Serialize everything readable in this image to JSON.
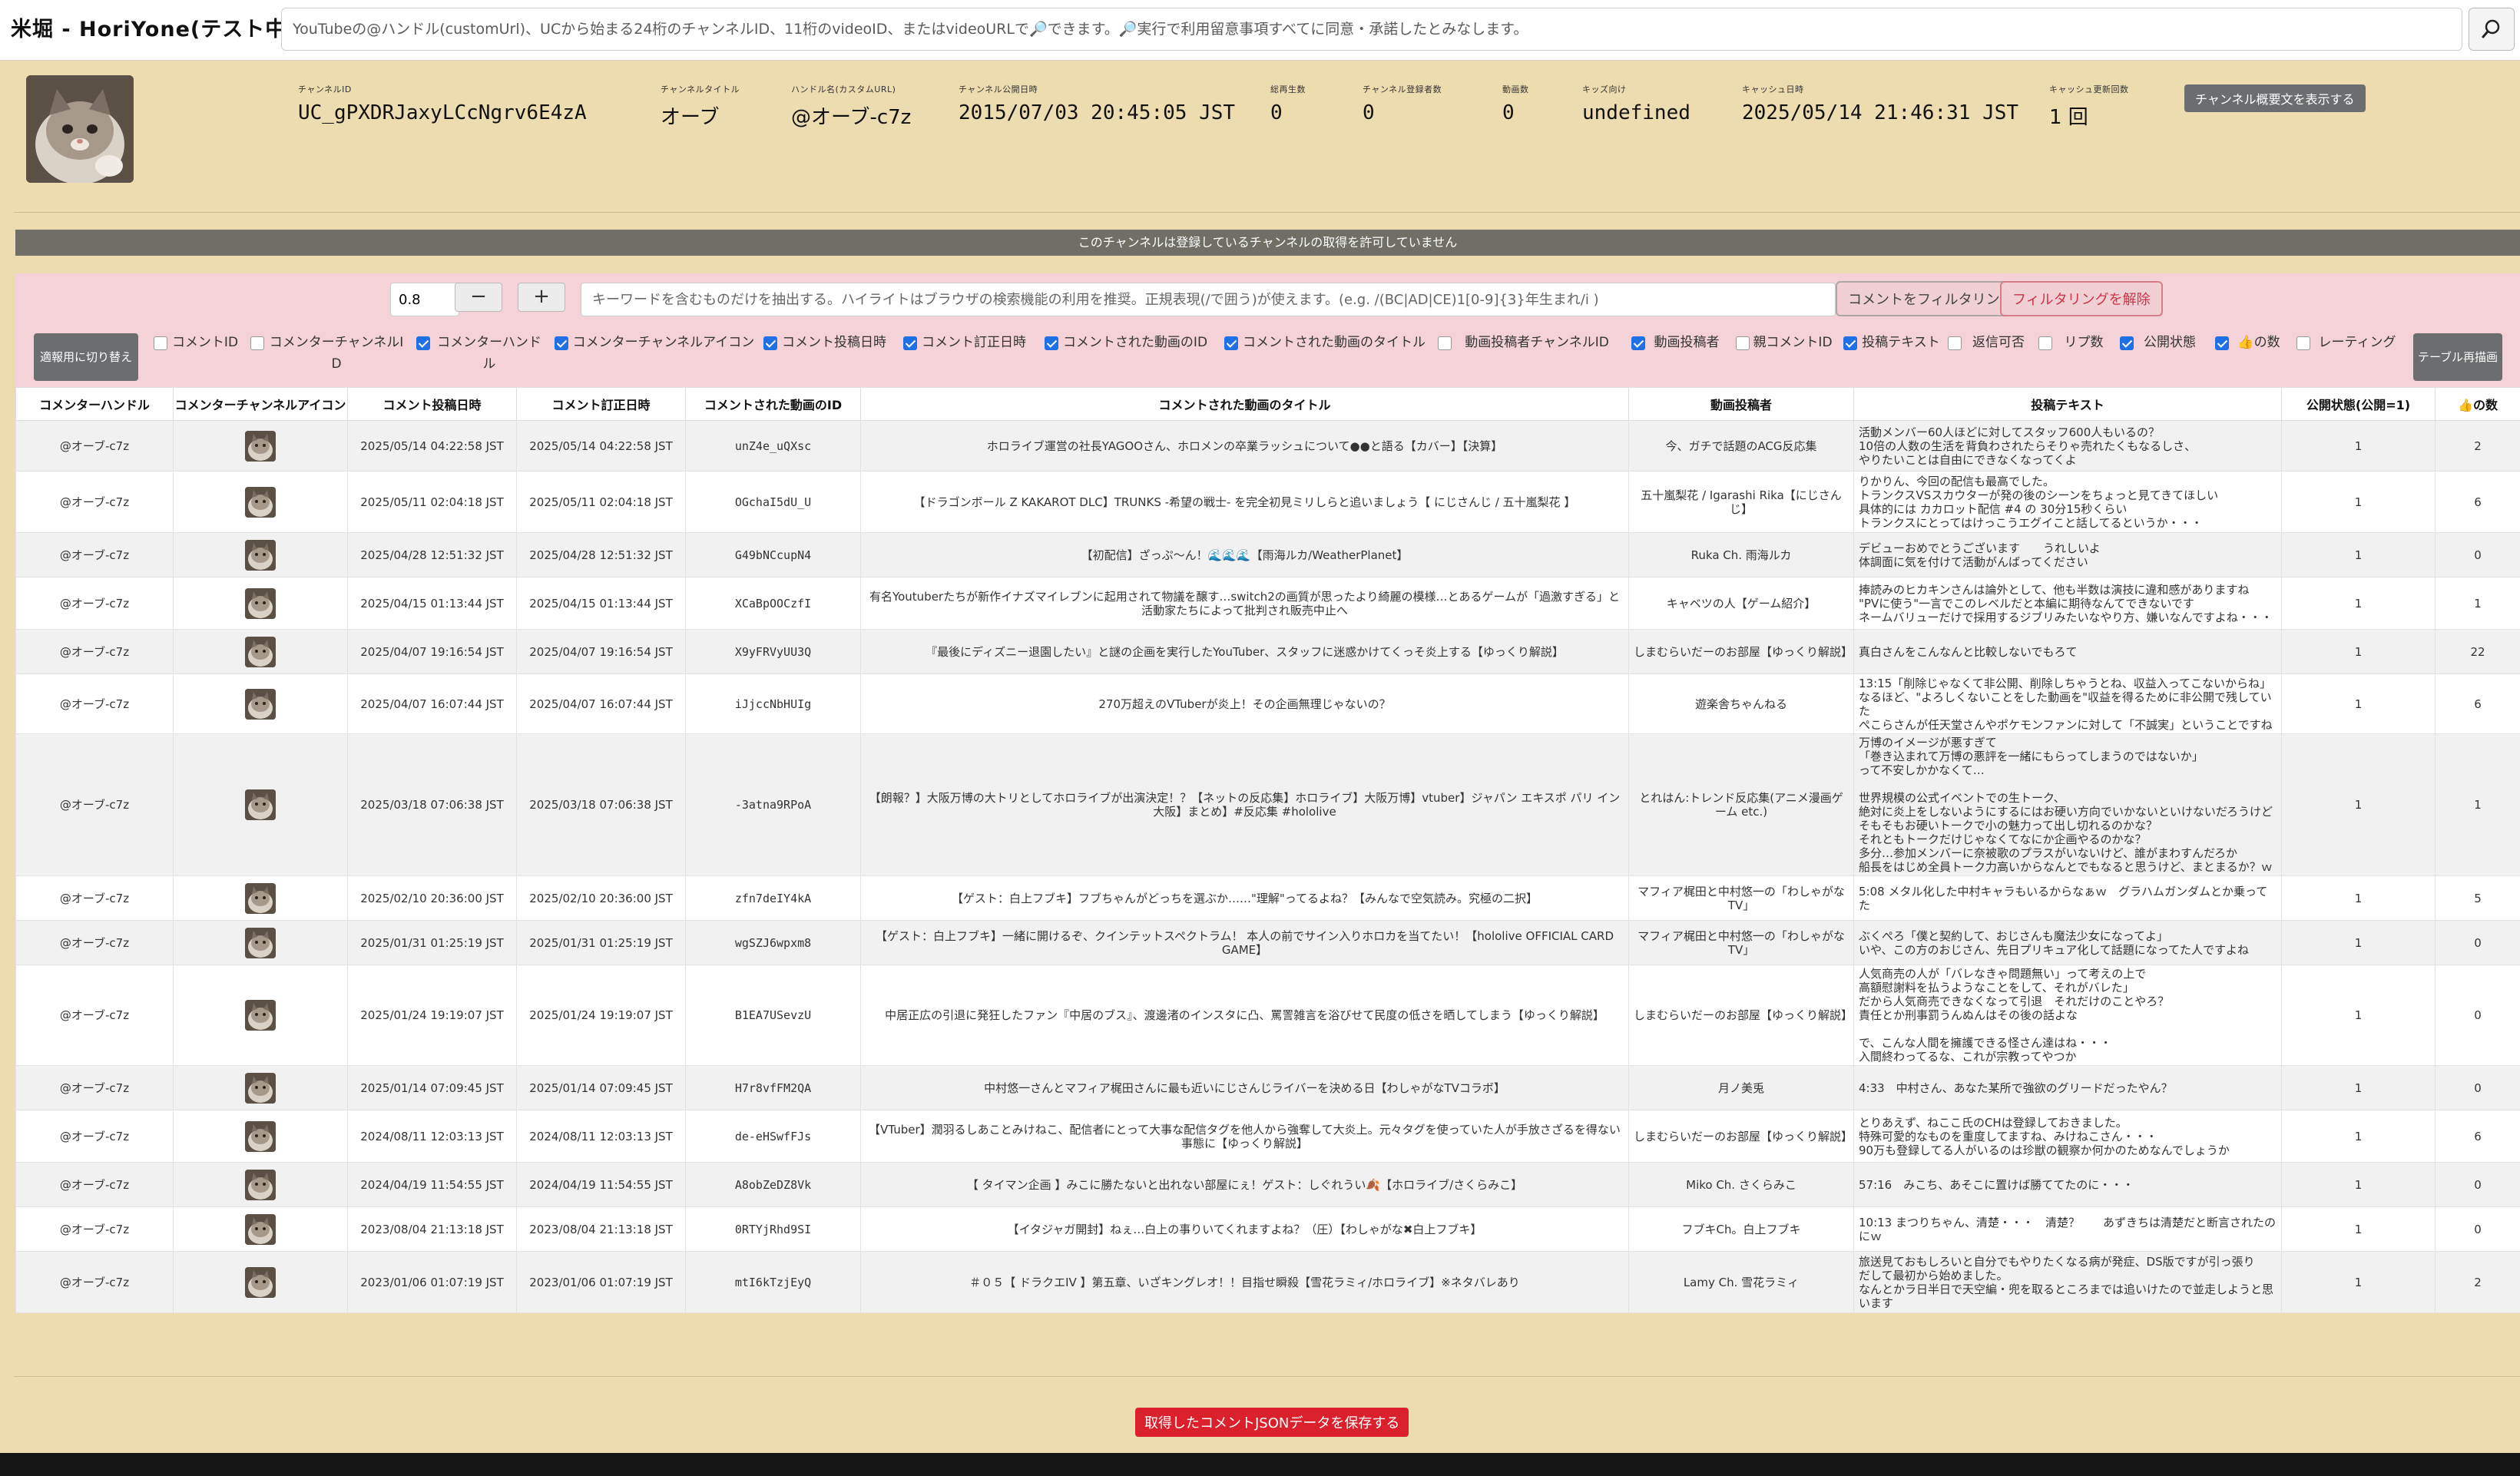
{
  "app": {
    "title": "米堀 - HoriYone(テスト中)",
    "search_placeholder": "YouTubeの@ハンドル(customUrl)、UCから始まる24桁のチャンネルID、11桁のvideoID、またはvideoURLで🔎できます。🔎実行で利用留意事項すべてに同意・承諾したとみなします。"
  },
  "channel": {
    "fields": [
      {
        "label": "チャンネルID",
        "value": "UC_gPXDRJaxyLCcNgrv6E4zA"
      },
      {
        "label": "チャンネルタイトル",
        "value": "オーブ"
      },
      {
        "label": "ハンドル名(カスタムURL)",
        "value": "@オーブ-c7z"
      },
      {
        "label": "チャンネル公開日時",
        "value": "2015/07/03 20:45:05 JST"
      },
      {
        "label": "総再生数",
        "value": "0"
      },
      {
        "label": "チャンネル登録者数",
        "value": "0"
      },
      {
        "label": "動画数",
        "value": "0"
      },
      {
        "label": "キッズ向け",
        "value": "undefined"
      },
      {
        "label": "キャッシュ日時",
        "value": "2025/05/14 21:46:31 JST"
      },
      {
        "label": "キャッシュ更新回数",
        "value": "1 回"
      }
    ],
    "show_description_label": "チャンネル概要文を表示する",
    "notice": "このチャンネルは登録しているチャンネルの取得を許可していません"
  },
  "filter": {
    "threshold_value": "0.8",
    "minus_label": "−",
    "plus_label": "+",
    "keyword_placeholder": "キーワードを含むものだけを抽出する。ハイライトはブラウザの検索機能の利用を推奨。正規表現(/で囲う)が使えます。(e.g. /(BC|AD|CE)1[0-9]{3}年生まれ/i )",
    "filter_button": "コメントをフィルタリング",
    "clear_button": "フィルタリングを解除",
    "toggle_button": "適報用に切り替え",
    "redraw_button": "テーブル再描画",
    "columns": [
      {
        "label": "コメントID",
        "checked": false
      },
      {
        "label": "コメンターチャンネルID",
        "checked": false
      },
      {
        "label": "コメンターハンドル",
        "checked": true
      },
      {
        "label": "コメンターチャンネルアイコン",
        "checked": true
      },
      {
        "label": "コメント投稿日時",
        "checked": true
      },
      {
        "label": "コメント訂正日時",
        "checked": true
      },
      {
        "label": "コメントされた動画のID",
        "checked": true
      },
      {
        "label": "コメントされた動画のタイトル",
        "checked": true
      },
      {
        "label": "動画投稿者チャンネルID",
        "checked": false
      },
      {
        "label": "動画投稿者",
        "checked": true
      },
      {
        "label": "親コメントID",
        "checked": false
      },
      {
        "label": "投稿テキスト",
        "checked": true
      },
      {
        "label": "返信可否",
        "checked": false
      },
      {
        "label": "リプ数",
        "checked": false
      },
      {
        "label": "公開状態",
        "checked": true
      },
      {
        "label": "👍の数",
        "checked": true
      },
      {
        "label": "レーティング",
        "checked": false
      }
    ]
  },
  "table": {
    "headers": [
      "コメンターハンドル",
      "コメンターチャンネルアイコン",
      "コメント投稿日時",
      "コメント訂正日時",
      "コメントされた動画のID",
      "コメントされた動画のタイトル",
      "動画投稿者",
      "投稿テキスト",
      "公開状態(公開=1)",
      "👍の数"
    ],
    "rows": [
      {
        "handle": "@オーブ-c7z",
        "posted": "2025/05/14 04:22:58 JST",
        "edited": "2025/05/14 04:22:58 JST",
        "video_id": "unZ4e_uQXsc",
        "title": "ホロライブ運営の社長YAGOOさん、ホロメンの卒業ラッシュについて●●と語る【カバー】【決算】",
        "uploader": "今、ガチで話題のACG反応集",
        "text": "活動メンバー60人ほどに対してスタッフ600人もいるの？\n10倍の人数の生活を背負わされたらそりゃ売れたくもなるしさ、\nやりたいことは自由にできなくなってくよ",
        "status": "1",
        "likes": "2"
      },
      {
        "handle": "@オーブ-c7z",
        "posted": "2025/05/11 02:04:18 JST",
        "edited": "2025/05/11 02:04:18 JST",
        "video_id": "OGchaI5dU_U",
        "title": "【ドラゴンボール Z KAKAROT DLC】TRUNKS -希望の戦士- を完全初見ミリしらと追いましょう【 にじさんじ / 五十嵐梨花 】",
        "uploader": "五十嵐梨花 / Igarashi Rika【にじさんじ】",
        "text": "りかりん、今回の配信も最高でした。\nトランクスVSスカウターが発の後のシーンをちょっと見てきてほしい\n具体的には カカロット配信 #4 の 30分15秒くらい\nトランクスにとってはけっこうエグイこと話してるというか・・・",
        "status": "1",
        "likes": "6"
      },
      {
        "handle": "@オーブ-c7z",
        "posted": "2025/04/28 12:51:32 JST",
        "edited": "2025/04/28 12:51:32 JST",
        "video_id": "G49bNCcupN4",
        "title": "【初配信】ざっぷ～ん！🌊🌊🌊【雨海ルカ/WeatherPlanet】",
        "uploader": "Ruka Ch. 雨海ルカ",
        "text": "デビューおめでとうございます　　うれしいよ\n体調面に気を付けて活動がんばってください",
        "status": "1",
        "likes": "0"
      },
      {
        "handle": "@オーブ-c7z",
        "posted": "2025/04/15 01:13:44 JST",
        "edited": "2025/04/15 01:13:44 JST",
        "video_id": "XCaBpOOCzfI",
        "title": "有名Youtuberたちが新作イナズマイレブンに起用されて物議を醸す…switch2の画質が思ったより綺麗の模様…とあるゲームが「過激すぎる」と活動家たちによって批判され販売中止へ",
        "uploader": "キャベツの人【ゲーム紹介】",
        "text": "捧読みのヒカキンさんは論外として、他も半数は演技に違和感がありますね\n\"PVに使う\"一言でこのレベルだと本編に期待なんてできないです\nネームバリューだけで採用するジブリみたいなやり方、嫌いなんですよね・・・",
        "status": "1",
        "likes": "1"
      },
      {
        "handle": "@オーブ-c7z",
        "posted": "2025/04/07 19:16:54 JST",
        "edited": "2025/04/07 19:16:54 JST",
        "video_id": "X9yFRVyUU3Q",
        "title": "『最後にディズニー退園したい』と謎の企画を実行したYouTuber、スタッフに迷惑かけてくっそ炎上する【ゆっくり解説】",
        "uploader": "しまむらいだーのお部屋【ゆっくり解説】",
        "text": "真白さんをこんなんと比較しないでもろて",
        "status": "1",
        "likes": "22"
      },
      {
        "handle": "@オーブ-c7z",
        "posted": "2025/04/07 16:07:44 JST",
        "edited": "2025/04/07 16:07:44 JST",
        "video_id": "iJjccNbHUIg",
        "title": "270万超えのVTuberが炎上！その企画無理じゃないの？",
        "uploader": "遊楽舎ちゃんねる",
        "text": "13:15「削除じゃなくて非公開、削除しちゃうとね、収益入ってこないからね」\nなるほど、\"よろしくないことをした動画を\"収益を得るために非公開で残していた\nぺこらさんが任天堂さんやポケモンファンに対して「不誠実」ということですね",
        "status": "1",
        "likes": "6"
      },
      {
        "handle": "@オーブ-c7z",
        "posted": "2025/03/18 07:06:38 JST",
        "edited": "2025/03/18 07:06:38 JST",
        "video_id": "-3atna9RPoA",
        "title": "【朗報？】大阪万博の大トリとしてホロライブが出演決定！？【ネットの反応集】ホロライブ】大阪万博】vtuber】ジャパン エキスポ パリ イン 大阪】まとめ】#反応集 #hololive",
        "uploader": "とれはん:トレンド反応集(アニメ漫画ゲーム etc.)",
        "text": "万博のイメージが悪すぎて\n「巻き込まれて万博の悪評を一緒にもらってしまうのではないか」\nって不安しかかなくて…\n\n世界規模の公式イベントでの生トーク、\n絶対に炎上をしないようにするにはお硬い方向でいかないといけないだろうけど\nそもそもお硬いトークで小の魅力って出し切れるのかな？\nそれともトークだけじゃなくてなにか企画やるのかな？\n多分…参加メンバーに奈被歌のプラスがいないけど、誰がまわすんだろか\n船長をはじめ全員トーク力高いからなんとでもなると思うけど、まとまるか？ｗ",
        "status": "1",
        "likes": "1"
      },
      {
        "handle": "@オーブ-c7z",
        "posted": "2025/02/10 20:36:00 JST",
        "edited": "2025/02/10 20:36:00 JST",
        "video_id": "zfn7deIY4kA",
        "title": "【ゲスト：白上フブキ】フブちゃんがどっちを選ぶか……\"理解\"ってるよね？【みんなで空気読み。究極の二択】",
        "uploader": "マフィア梶田と中村悠一の「わしゃがなTV」",
        "text": "5:08 メタル化した中村キャラもいるからなぁｗ　グラハムガンダムとか乗ってた",
        "status": "1",
        "likes": "5"
      },
      {
        "handle": "@オーブ-c7z",
        "posted": "2025/01/31 01:25:19 JST",
        "edited": "2025/01/31 01:25:19 JST",
        "video_id": "wgSZJ6wpxm8",
        "title": "【ゲスト：白上フブキ】一緒に開けるぞ、クインテットスペクトラム！ 本人の前でサイン入りホロカを当てたい！【hololive OFFICIAL CARD GAME】",
        "uploader": "マフィア梶田と中村悠一の「わしゃがなTV」",
        "text": "ぶくぺろ「僕と契約して、おじさんも魔法少女になってよ」\nいや、この方のおじさん、先日プリキュア化して話題になってた人ですよね",
        "status": "1",
        "likes": "0"
      },
      {
        "handle": "@オーブ-c7z",
        "posted": "2025/01/24 19:19:07 JST",
        "edited": "2025/01/24 19:19:07 JST",
        "video_id": "B1EA7USevzU",
        "title": "中居正広の引退に発狂したファン『中居のブス』、渡邊渚のインスタに凸、罵詈雑言を浴びせて民度の低さを晒してしまう【ゆっくり解説】",
        "uploader": "しまむらいだーのお部屋【ゆっくり解説】",
        "text": "人気商売の人が「バレなきゃ問題無い」って考えの上で\n高額慰謝料を払うようなことをして、それがバレた」\nだから人気商売できなくなって引退　それだけのことやろ？\n責任とか刑事罰うんぬんはその後の話よな\n\nで、こんな人間を擁護できる怪さん達はね・・・\n入間終わってるな、これが宗教ってやつか",
        "status": "1",
        "likes": "0"
      },
      {
        "handle": "@オーブ-c7z",
        "posted": "2025/01/14 07:09:45 JST",
        "edited": "2025/01/14 07:09:45 JST",
        "video_id": "H7r8vfFM2QA",
        "title": "中村悠一さんとマフィア梶田さんに最も近いにじさんじライバーを決める日【わしゃがなTVコラボ】",
        "uploader": "月ノ美兎",
        "text": "4:33　中村さん、あなた某所で強欲のグリードだったやん？",
        "status": "1",
        "likes": "0"
      },
      {
        "handle": "@オーブ-c7z",
        "posted": "2024/08/11 12:03:13 JST",
        "edited": "2024/08/11 12:03:13 JST",
        "video_id": "de-eHSwfFJs",
        "title": "【VTuber】潤羽るしあことみけねこ、配信者にとって大事な配信タグを他人から強奪して大炎上。元々タグを使っていた人が手放さざるを得ない事態に【ゆっくり解説】",
        "uploader": "しまむらいだーのお部屋【ゆっくり解説】",
        "text": "とりあえず、ねここ氏のCHは登録しておきました。\n特殊可愛的なものを重度してますね、みけねこさん・・・\n90万も登録してる人がいるのは珍獣の観察か何かのためなんでしょうか",
        "status": "1",
        "likes": "6"
      },
      {
        "handle": "@オーブ-c7z",
        "posted": "2024/04/19 11:54:55 JST",
        "edited": "2024/04/19 11:54:55 JST",
        "video_id": "A8obZeDZ8Vk",
        "title": "【 タイマン企画 】みこに勝たないと出れない部屋にぇ！ゲスト：しぐれうい🍂【ホロライブ/さくらみこ】",
        "uploader": "Miko Ch. さくらみこ",
        "text": "57:16　みこち、あそこに置けば勝ててたのに・・・",
        "status": "1",
        "likes": "0"
      },
      {
        "handle": "@オーブ-c7z",
        "posted": "2023/08/04 21:13:18 JST",
        "edited": "2023/08/04 21:13:18 JST",
        "video_id": "0RTYjRhd9SI",
        "title": "【イタジャガ開封】ねぇ…白上の事りいてくれますよね？（圧）【わしゃがな✖白上フブキ】",
        "uploader": "フブキCh。白上フブキ",
        "text": "10:13 まつりちゃん、清楚・・・　清楚？　　あずきちは清楚だと断言されたのにｗ",
        "status": "1",
        "likes": "0"
      },
      {
        "handle": "@オーブ-c7z",
        "posted": "2023/01/06 01:07:19 JST",
        "edited": "2023/01/06 01:07:19 JST",
        "video_id": "mtI6kTzjEyQ",
        "title": "＃０５【 ドラクエIV 】第五章、いざキングレオ！！目指せ瞬殺【雪花ラミィ/ホロライブ】※ネタバレあり",
        "uploader": "Lamy Ch. 雪花ラミィ",
        "text": "旅送見ておもしろいと自分でもやりたくなる病が発症、DS版ですが引っ張り\nだして最初から始めました。\nなんとかラ日半日で天空編・兜を取るところまでは追いけたので並走しようと思います",
        "status": "1",
        "likes": "2"
      }
    ]
  },
  "footer": {
    "save_button": "取得したコメントJSONデータを保存する"
  }
}
